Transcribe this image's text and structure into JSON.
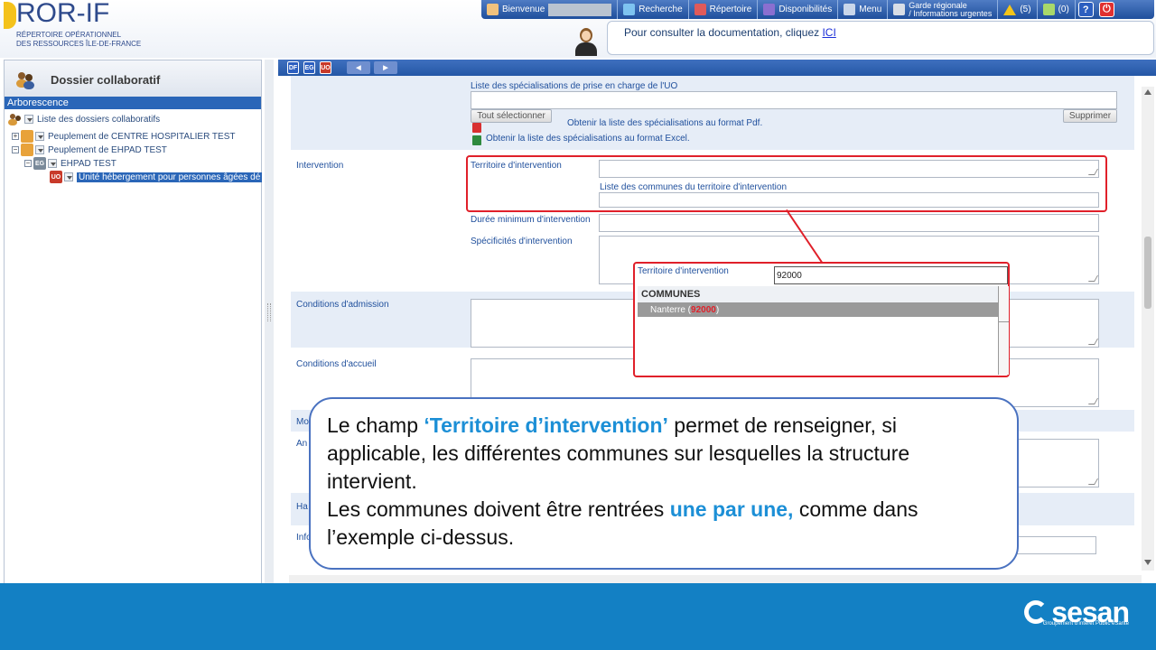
{
  "header": {
    "logo_title": "ROR-IF",
    "logo_subtitle_1": "RÉPERTOIRE OPÉRATIONNEL",
    "logo_subtitle_2": "DES RESSOURCES ÎLE-DE-FRANCE",
    "nav": {
      "bienvenue": "Bienvenue",
      "recherche": "Recherche",
      "repertoire": "Répertoire",
      "disponibilites": "Disponibilités",
      "menu": "Menu",
      "garde_line1": "Garde régionale",
      "garde_line2": "/ Informations urgentes",
      "alerts_count": "(5)",
      "messages_count": "(0)",
      "help": "?"
    },
    "doc_message": "Pour consulter la documentation, cliquez ",
    "doc_link": "ICI"
  },
  "left_panel": {
    "title": "Dossier collaboratif",
    "section": "Arborescence",
    "tree": {
      "root": "Liste des dossiers collaboratifs",
      "node1": "Peuplement de CENTRE HOSPITALIER TEST",
      "node2": "Peuplement de EHPAD TEST",
      "node3_badge": "EG",
      "node3": "EHPAD TEST",
      "node4_badge": "UO",
      "node4": "Unité hébergement pour personnes âgées dé"
    }
  },
  "main_toolbar": {
    "btn_df": "DF",
    "btn_eg": "EG",
    "btn_uo": "UO"
  },
  "form": {
    "specialisations_label": "Liste des spécialisations de prise en charge de l'UO",
    "select_all": "Tout sélectionner",
    "delete": "Supprimer",
    "pdf_link": "Obtenir la liste des spécialisations au format Pdf.",
    "excel_link": "Obtenir la liste des spécialisations au format Excel.",
    "intervention_section": "Intervention",
    "territoire_label": "Territoire d'intervention",
    "communes_label": "Liste des communes du territoire d'intervention",
    "duree_label": "Durée minimum d'intervention",
    "specificites_label": "Spécificités d'intervention",
    "admission_section": "Conditions d'admission",
    "accueil_section": "Conditions d'accueil",
    "partial_mo": "Mo",
    "partial_an": "An",
    "partial_ha": "Ha",
    "partial_inf": "Info"
  },
  "autocomplete": {
    "label": "Territoire d'intervention",
    "input_value": "92000",
    "group_header": "COMMUNES",
    "item_name": "Nanterre (",
    "item_code": "92000",
    "item_close": ")"
  },
  "callout": {
    "p1_a": "Le champ ",
    "p1_highlight": "‘Territoire d’intervention’",
    "p1_b": " permet de renseigner, si applicable, les différentes communes sur lesquelles la structure intervient.",
    "p2_a": "Les communes doivent être rentrées ",
    "p2_highlight": "une par une,",
    "p2_b": " comme dans l’exemple ci-dessus."
  },
  "footer": {
    "brand": "sesan",
    "tagline": "Groupement d'Intérêt Public eSanté"
  },
  "colors": {
    "accent_blue": "#2a66b8",
    "highlight_red": "#e0202a",
    "footer_blue": "#1380c4",
    "callout_blue": "#1c8fd6"
  }
}
